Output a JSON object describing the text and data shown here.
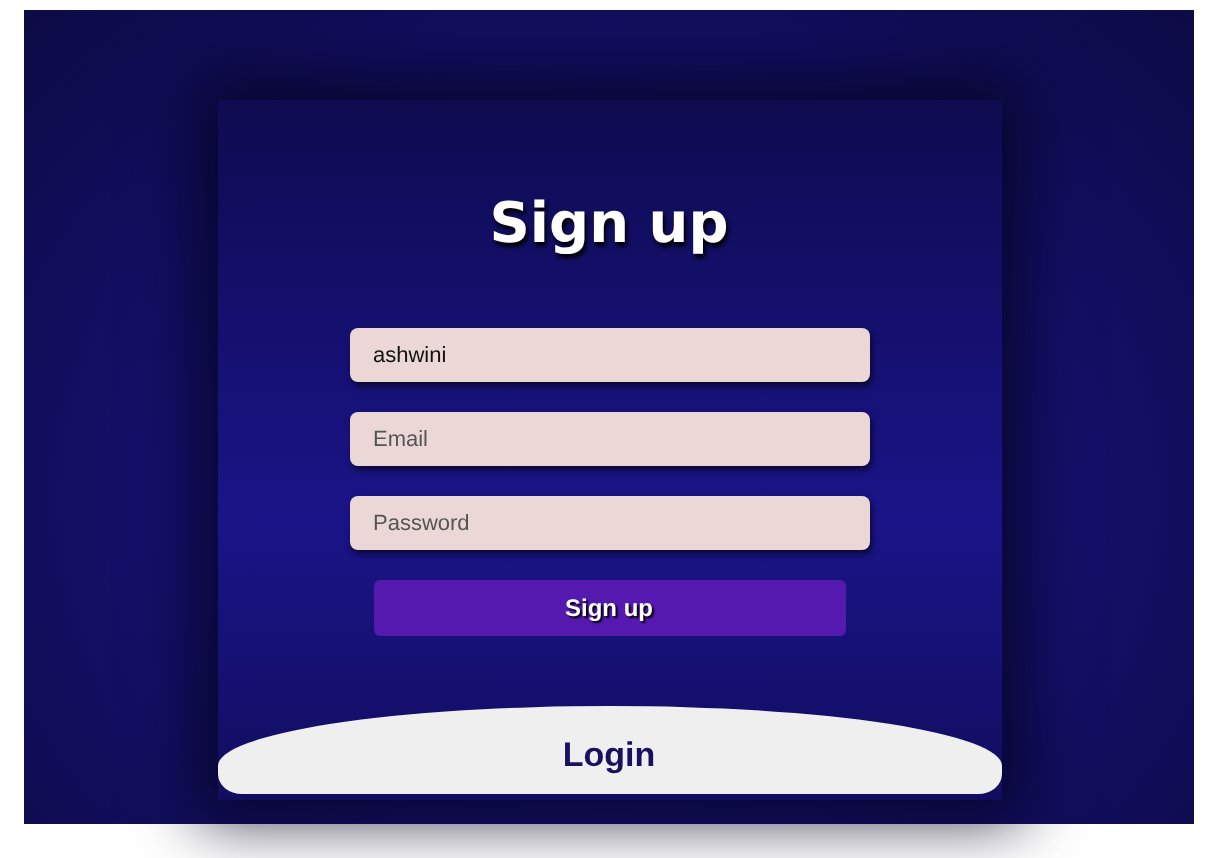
{
  "title": "Sign up",
  "fields": [
    {
      "value": "ashwini"
    },
    {
      "placeholder": "Email"
    },
    {
      "placeholder": "Password"
    }
  ],
  "submit": "Sign up",
  "login": "Login"
}
